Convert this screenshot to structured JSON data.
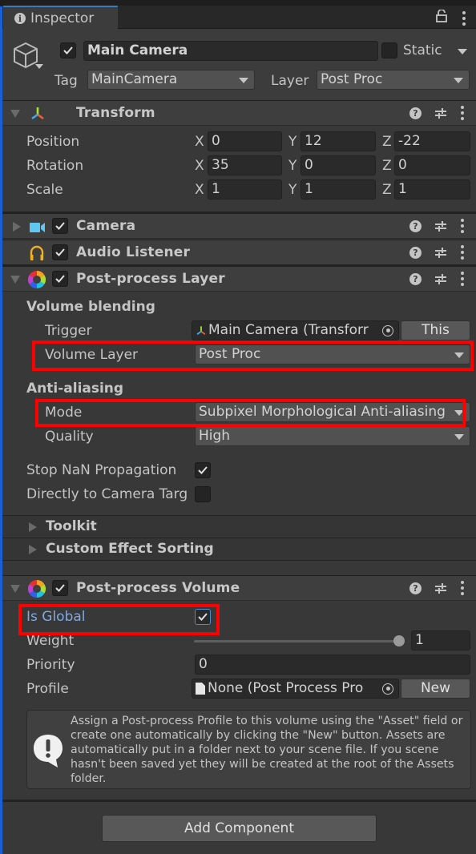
{
  "tab": {
    "title": "Inspector",
    "icon": "info-icon"
  },
  "gameobject": {
    "active": true,
    "name": "Main Camera",
    "static_label": "Static",
    "static": false,
    "tag_label": "Tag",
    "tag_value": "MainCamera",
    "layer_label": "Layer",
    "layer_value": "Post Proc"
  },
  "transform": {
    "title": "Transform",
    "expanded": true,
    "rows": [
      {
        "label": "Position",
        "x": "0",
        "y": "12",
        "z": "-22"
      },
      {
        "label": "Rotation",
        "x": "35",
        "y": "0",
        "z": "0"
      },
      {
        "label": "Scale",
        "x": "1",
        "y": "1",
        "z": "1"
      }
    ],
    "axis_labels": {
      "x": "X",
      "y": "Y",
      "z": "Z"
    }
  },
  "camera": {
    "title": "Camera",
    "enabled": true,
    "expanded": false
  },
  "audio_listener": {
    "title": "Audio Listener",
    "enabled": true
  },
  "postprocess_layer": {
    "title": "Post-process Layer",
    "enabled": true,
    "expanded": true,
    "volume_blending": {
      "heading": "Volume blending",
      "trigger_label": "Trigger",
      "trigger_value": "Main Camera (Transform)",
      "trigger_value_visible": "Main Camera (Transforr",
      "this_button": "This",
      "volume_layer_label": "Volume Layer",
      "volume_layer_value": "Post Proc"
    },
    "anti_aliasing": {
      "heading": "Anti-aliasing",
      "mode_label": "Mode",
      "mode_value": "Subpixel Morphological Anti-aliasing",
      "quality_label": "Quality",
      "quality_value": "High"
    },
    "stop_nan_label": "Stop NaN Propagation",
    "stop_nan": true,
    "direct_to_camera_label": "Directly to Camera Targ",
    "direct_to_camera": false,
    "toolkit_label": "Toolkit",
    "custom_effect_sorting_label": "Custom Effect Sorting"
  },
  "postprocess_volume": {
    "title": "Post-process Volume",
    "enabled": true,
    "expanded": true,
    "is_global_label": "Is Global",
    "is_global": true,
    "weight_label": "Weight",
    "weight_value": "1",
    "weight_fraction": 1.0,
    "priority_label": "Priority",
    "priority_value": "0",
    "profile_label": "Profile",
    "profile_value": "None (Post Process Profile)",
    "profile_value_visible": "None (Post Process Pro",
    "new_button": "New",
    "help_text": "Assign a Post-process Profile to this volume using the \"Asset\" field or create one automatically by clicking the \"New\" button. Assets are automatically put in a folder next to your scene file. If you scene hasn't been saved yet they will be created at the root of the Assets folder."
  },
  "add_component_button": "Add Component",
  "colors": {
    "highlight": "#ff0000",
    "accent_blue": "#1a5fd6",
    "is_global_label": "#7fa9e0",
    "panel": "#383838"
  }
}
